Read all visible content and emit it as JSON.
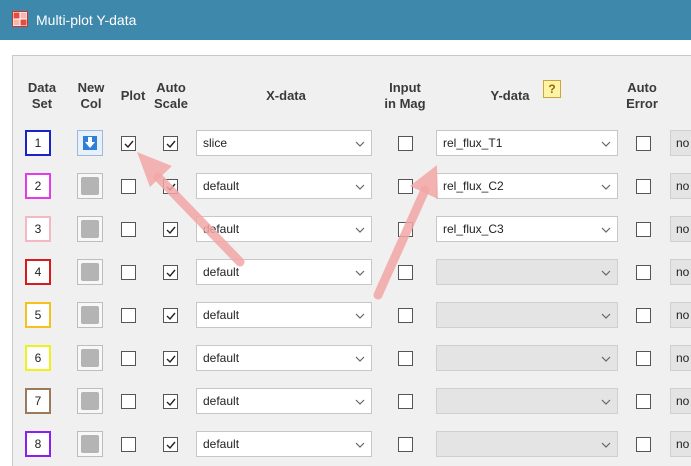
{
  "window": {
    "title": "Multi-plot Y-data"
  },
  "headers": {
    "data_set": "Data\nSet",
    "new_col": "New\nCol",
    "plot": "Plot",
    "auto_scale": "Auto\nScale",
    "x_data": "X-data",
    "input_in_mag": "Input\nin Mag",
    "y_data": "Y-data",
    "auto_error": "Auto\nError"
  },
  "icons": {
    "window": "multi-plot-app-icon",
    "help": "help-icon",
    "new_col_active": "blue-down-arrow-icon",
    "dropdown": "chevron-down-icon"
  },
  "rows": [
    {
      "set": "1",
      "color": "#1a23c8",
      "plot": true,
      "auto_scale": true,
      "x_data": "slice",
      "input_in_mag": false,
      "y_data": "rel_flux_T1",
      "y_enabled": true,
      "auto_error": false,
      "tail": "no",
      "newcol_active": true
    },
    {
      "set": "2",
      "color": "#e43be8",
      "plot": false,
      "auto_scale": true,
      "x_data": "default",
      "input_in_mag": false,
      "y_data": "rel_flux_C2",
      "y_enabled": true,
      "auto_error": false,
      "tail": "no",
      "newcol_active": false
    },
    {
      "set": "3",
      "color": "#f4b8c2",
      "plot": false,
      "auto_scale": true,
      "x_data": "default",
      "input_in_mag": false,
      "y_data": "rel_flux_C3",
      "y_enabled": true,
      "auto_error": false,
      "tail": "no",
      "newcol_active": false
    },
    {
      "set": "4",
      "color": "#d81a1a",
      "plot": false,
      "auto_scale": true,
      "x_data": "default",
      "input_in_mag": false,
      "y_data": "",
      "y_enabled": false,
      "auto_error": false,
      "tail": "no",
      "newcol_active": false
    },
    {
      "set": "5",
      "color": "#f5c11c",
      "plot": false,
      "auto_scale": true,
      "x_data": "default",
      "input_in_mag": false,
      "y_data": "",
      "y_enabled": false,
      "auto_error": false,
      "tail": "no",
      "newcol_active": false
    },
    {
      "set": "6",
      "color": "#eef21a",
      "plot": false,
      "auto_scale": true,
      "x_data": "default",
      "input_in_mag": false,
      "y_data": "",
      "y_enabled": false,
      "auto_error": false,
      "tail": "no",
      "newcol_active": false
    },
    {
      "set": "7",
      "color": "#9b7a5c",
      "plot": false,
      "auto_scale": true,
      "x_data": "default",
      "input_in_mag": false,
      "y_data": "",
      "y_enabled": false,
      "auto_error": false,
      "tail": "no",
      "newcol_active": false
    },
    {
      "set": "8",
      "color": "#8a1ff0",
      "plot": false,
      "auto_scale": true,
      "x_data": "default",
      "input_in_mag": false,
      "y_data": "",
      "y_enabled": false,
      "auto_error": false,
      "tail": "no",
      "newcol_active": false
    }
  ],
  "annotation_color": "#f3a7a7"
}
